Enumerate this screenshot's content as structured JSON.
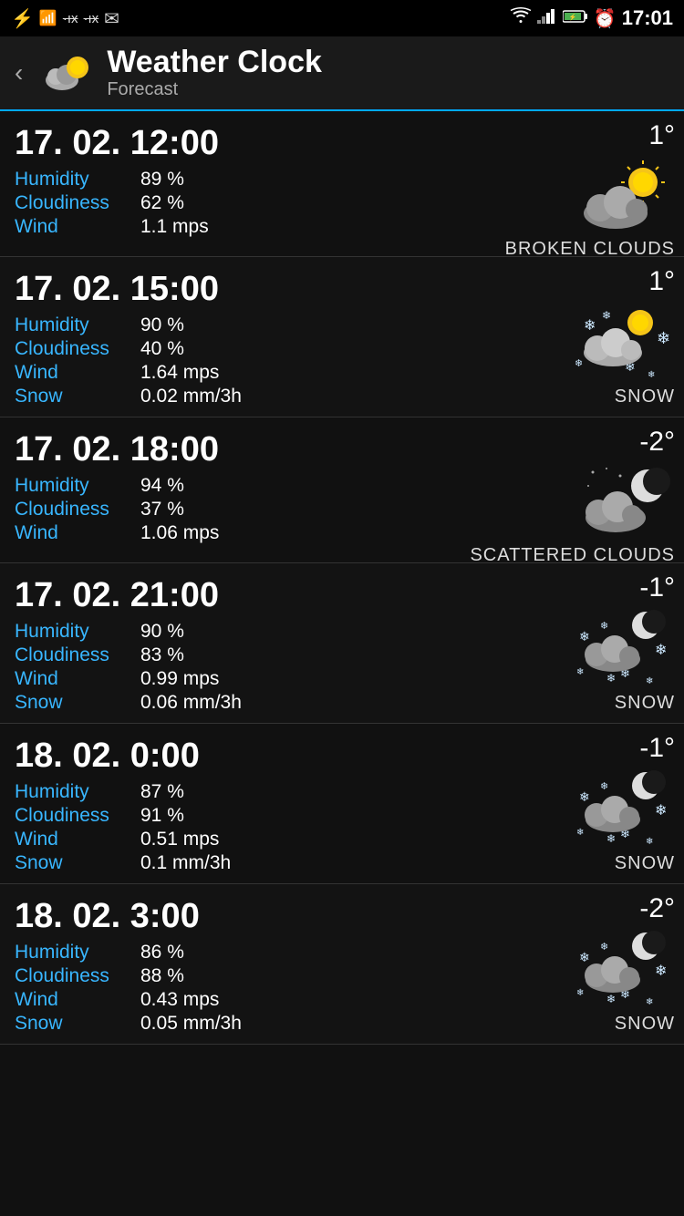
{
  "statusBar": {
    "time": "17:01",
    "icons": [
      "usb",
      "sim",
      "signal-x1",
      "signal-x2",
      "email",
      "wifi",
      "cellular",
      "battery",
      "alarm"
    ]
  },
  "header": {
    "title": "Weather Clock",
    "subtitle": "Forecast",
    "backArrow": "‹"
  },
  "forecasts": [
    {
      "datetime": "17. 02. 12:00",
      "details": [
        {
          "label": "Humidity",
          "value": "89 %"
        },
        {
          "label": "Cloudiness",
          "value": "62 %"
        },
        {
          "label": "Wind",
          "value": "1.1 mps"
        }
      ],
      "temperature": "1°",
      "condition": "BROKEN CLOUDS",
      "iconType": "broken-clouds-day"
    },
    {
      "datetime": "17. 02. 15:00",
      "details": [
        {
          "label": "Humidity",
          "value": "90 %"
        },
        {
          "label": "Cloudiness",
          "value": "40 %"
        },
        {
          "label": "Wind",
          "value": "1.64 mps"
        },
        {
          "label": "Snow",
          "value": "0.02 mm/3h"
        }
      ],
      "temperature": "1°",
      "condition": "SNOW",
      "iconType": "snow-day"
    },
    {
      "datetime": "17. 02. 18:00",
      "details": [
        {
          "label": "Humidity",
          "value": "94 %"
        },
        {
          "label": "Cloudiness",
          "value": "37 %"
        },
        {
          "label": "Wind",
          "value": "1.06 mps"
        }
      ],
      "temperature": "-2°",
      "condition": "SCATTERED CLOUDS",
      "iconType": "scattered-clouds-night"
    },
    {
      "datetime": "17. 02. 21:00",
      "details": [
        {
          "label": "Humidity",
          "value": "90 %"
        },
        {
          "label": "Cloudiness",
          "value": "83 %"
        },
        {
          "label": "Wind",
          "value": "0.99 mps"
        },
        {
          "label": "Snow",
          "value": "0.06 mm/3h"
        }
      ],
      "temperature": "-1°",
      "condition": "SNOW",
      "iconType": "snow-night"
    },
    {
      "datetime": "18. 02. 0:00",
      "details": [
        {
          "label": "Humidity",
          "value": "87 %"
        },
        {
          "label": "Cloudiness",
          "value": "91 %"
        },
        {
          "label": "Wind",
          "value": "0.51 mps"
        },
        {
          "label": "Snow",
          "value": "0.1 mm/3h"
        }
      ],
      "temperature": "-1°",
      "condition": "SNOW",
      "iconType": "snow-night"
    },
    {
      "datetime": "18. 02. 3:00",
      "details": [
        {
          "label": "Humidity",
          "value": "86 %"
        },
        {
          "label": "Cloudiness",
          "value": "88 %"
        },
        {
          "label": "Wind",
          "value": "0.43 mps"
        },
        {
          "label": "Snow",
          "value": "0.05 mm/3h"
        }
      ],
      "temperature": "-2°",
      "condition": "SNOW",
      "iconType": "snow-night"
    }
  ]
}
